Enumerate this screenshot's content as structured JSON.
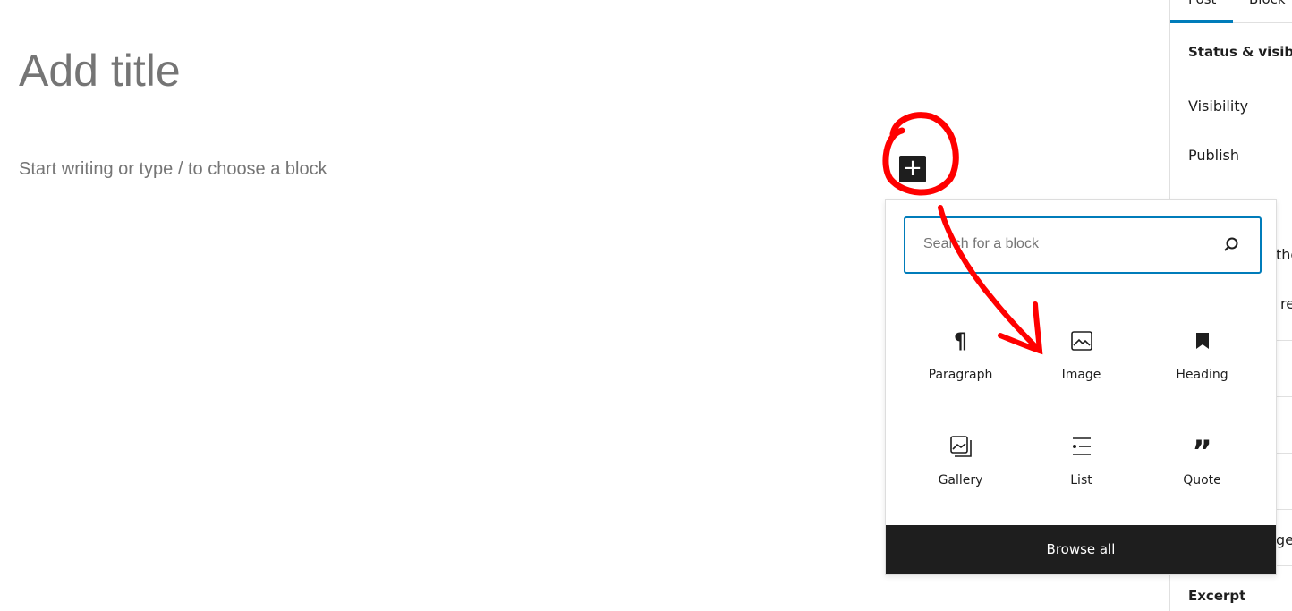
{
  "editor": {
    "title_placeholder": "Add title",
    "body_placeholder": "Start writing or type / to choose a block"
  },
  "sidebar": {
    "tabs": [
      {
        "label": "Post",
        "active": true
      },
      {
        "label": "Block"
      }
    ],
    "section_title": "Status & visibilit",
    "items": [
      "Visibility",
      "Publish",
      "the",
      "re",
      "ge"
    ],
    "excerpt": "Excerpt"
  },
  "inserter": {
    "search_placeholder": "Search for a block",
    "blocks": [
      {
        "label": "Paragraph",
        "icon": "paragraph-icon"
      },
      {
        "label": "Image",
        "icon": "image-icon"
      },
      {
        "label": "Heading",
        "icon": "bookmark-icon"
      },
      {
        "label": "Gallery",
        "icon": "gallery-icon"
      },
      {
        "label": "List",
        "icon": "list-icon"
      },
      {
        "label": "Quote",
        "icon": "quote-icon"
      }
    ],
    "browse_all": "Browse all"
  },
  "colors": {
    "accent": "#007cba",
    "dark": "#1e1e1e",
    "annotation": "#ff0000"
  }
}
